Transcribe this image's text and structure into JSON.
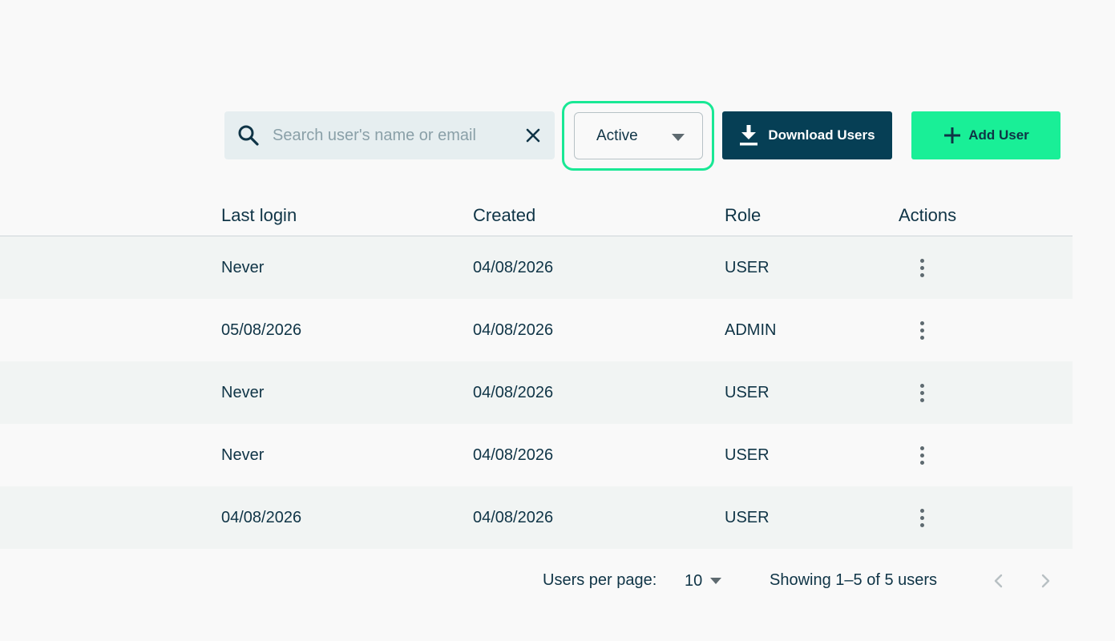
{
  "toolbar": {
    "search": {
      "placeholder": "Search user's name or email",
      "value": ""
    },
    "status_filter": {
      "selected": "Active"
    },
    "download_label": "Download Users",
    "add_label": "Add User"
  },
  "table": {
    "headers": [
      "Last login",
      "Created",
      "Role",
      "Actions"
    ],
    "rows": [
      {
        "last_login": "Never",
        "created": "04/08/2026",
        "role": "USER"
      },
      {
        "last_login": "05/08/2026",
        "created": "04/08/2026",
        "role": "ADMIN"
      },
      {
        "last_login": "Never",
        "created": "04/08/2026",
        "role": "USER"
      },
      {
        "last_login": "Never",
        "created": "04/08/2026",
        "role": "USER"
      },
      {
        "last_login": "04/08/2026",
        "created": "04/08/2026",
        "role": "USER"
      }
    ]
  },
  "pagination": {
    "per_page_label": "Users per page:",
    "per_page_value": "10",
    "showing_text": "Showing 1–5 of 5 users"
  },
  "colors": {
    "accent_green": "#19ef97",
    "dark_teal": "#063f55",
    "text": "#0f3446"
  }
}
